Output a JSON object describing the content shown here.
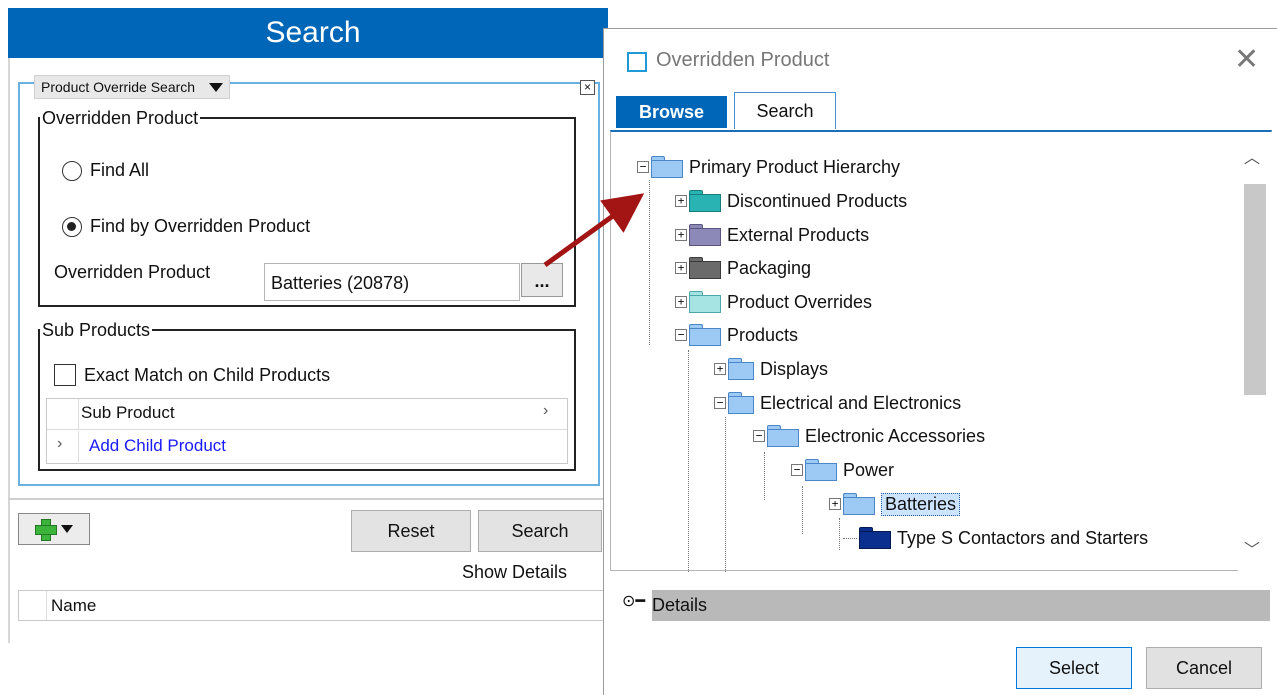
{
  "search_panel": {
    "title": "Search",
    "override_dropdown": "Product Override Search",
    "close_box": "×",
    "overridden_group": {
      "legend": "Overridden Product",
      "find_all": "Find All",
      "find_by": "Find by Overridden Product",
      "field_label": "Overridden Product",
      "field_value": "Batteries (20878)",
      "ellipsis": "..."
    },
    "sub_group": {
      "legend": "Sub Products",
      "exact_match": "Exact Match on Child Products",
      "column_header": "Sub Product",
      "add_child": "Add Child Product"
    },
    "reset_label": "Reset",
    "search_label": "Search",
    "show_details": "Show Details",
    "name_column": "Name"
  },
  "dialog": {
    "title": "Overridden Product",
    "close": "✕",
    "tabs": {
      "browse": "Browse",
      "search": "Search"
    },
    "tree": {
      "root": "Primary Product Hierarchy",
      "discontinued": "Discontinued Products",
      "external": "External Products",
      "packaging": "Packaging",
      "overrides": "Product Overrides",
      "products": "Products",
      "displays": "Displays",
      "electrical": "Electrical and Electronics",
      "accessories": "Electronic Accessories",
      "power": "Power",
      "batteries": "Batteries",
      "contactors": "Type S Contactors and Starters"
    },
    "details_label": "Details",
    "select_label": "Select",
    "cancel_label": "Cancel"
  },
  "colors": {
    "accent_blue": "#0067b8",
    "folder_blue": "#9ccaf5",
    "folder_teal": "#2ab3b3",
    "folder_purple": "#8c88b8",
    "folder_gray": "#6a6a6a",
    "folder_light_teal": "#a6e3e3",
    "folder_dark_blue": "#0b2f8f",
    "arrow_red": "#a31515"
  }
}
